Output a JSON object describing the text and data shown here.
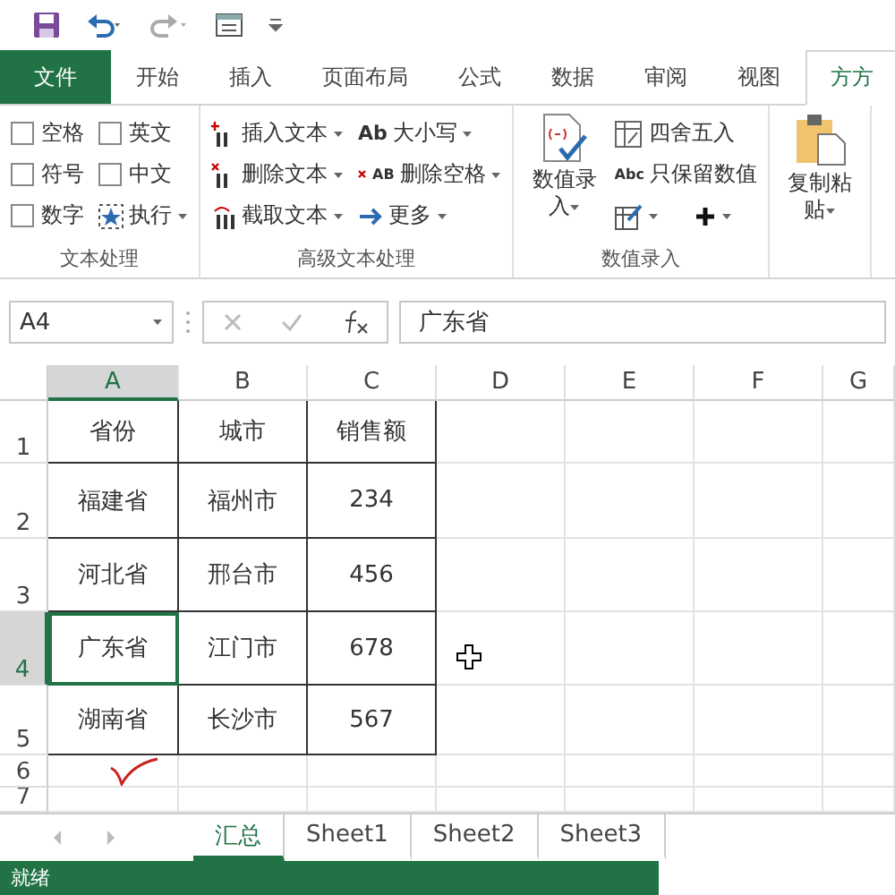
{
  "tabs": [
    {
      "label": "文件",
      "kind": "file",
      "selected": false
    },
    {
      "label": "开始",
      "kind": "tab",
      "selected": false
    },
    {
      "label": "插入",
      "kind": "tab",
      "selected": false
    },
    {
      "label": "页面布局",
      "kind": "tab",
      "selected": false
    },
    {
      "label": "公式",
      "kind": "tab",
      "selected": false
    },
    {
      "label": "数据",
      "kind": "tab",
      "selected": false
    },
    {
      "label": "审阅",
      "kind": "tab",
      "selected": false
    },
    {
      "label": "视图",
      "kind": "tab",
      "selected": false
    },
    {
      "label": "方方",
      "kind": "tab",
      "selected": true
    }
  ],
  "ribbon": {
    "text_group": {
      "label": "文本处理",
      "checkboxes": [
        {
          "label": "空格",
          "checked": false
        },
        {
          "label": "英文",
          "checked": false
        },
        {
          "label": "符号",
          "checked": false
        },
        {
          "label": "中文",
          "checked": false
        },
        {
          "label": "数字",
          "checked": false
        }
      ],
      "run_button": "执行"
    },
    "advanced_group": {
      "label": "高级文本处理",
      "items": [
        {
          "label": "插入文本"
        },
        {
          "label": "大小写",
          "glyph": "Ab"
        },
        {
          "label": "删除文本"
        },
        {
          "label": "删除空格",
          "glyph": "AB"
        },
        {
          "label": "截取文本"
        },
        {
          "label": "更多"
        }
      ]
    },
    "number_group": {
      "label": "数值录入",
      "big_button": "数值录入",
      "small": [
        {
          "label": "四舍五入"
        },
        {
          "label": "只保留数值",
          "glyph": "Abc"
        }
      ]
    },
    "paste_button": "复制粘贴"
  },
  "formula_bar": {
    "name_box": "A4",
    "formula": "广东省"
  },
  "columns": [
    {
      "label": "A",
      "selected": true
    },
    {
      "label": "B",
      "selected": false
    },
    {
      "label": "C",
      "selected": false
    },
    {
      "label": "D",
      "selected": false
    },
    {
      "label": "E",
      "selected": false
    },
    {
      "label": "F",
      "selected": false
    },
    {
      "label": "G",
      "selected": false
    }
  ],
  "rows": [
    {
      "label": "1",
      "selected": false,
      "cells": [
        "省份",
        "城市",
        "销售额"
      ]
    },
    {
      "label": "2",
      "selected": false,
      "cells": [
        "福建省",
        "福州市",
        "234"
      ]
    },
    {
      "label": "3",
      "selected": false,
      "cells": [
        "河北省",
        "邢台市",
        "456"
      ]
    },
    {
      "label": "4",
      "selected": true,
      "cells": [
        "广东省",
        "江门市",
        "678"
      ]
    },
    {
      "label": "5",
      "selected": false,
      "cells": [
        "湖南省",
        "长沙市",
        "567"
      ]
    },
    {
      "label": "6",
      "selected": false,
      "cells": []
    },
    {
      "label": "7",
      "selected": false,
      "cells": []
    }
  ],
  "sheet_tabs": [
    {
      "label": "汇总",
      "selected": true
    },
    {
      "label": "Sheet1",
      "selected": false
    },
    {
      "label": "Sheet2",
      "selected": false
    },
    {
      "label": "Sheet3",
      "selected": false
    }
  ],
  "status_bar": "就绪"
}
